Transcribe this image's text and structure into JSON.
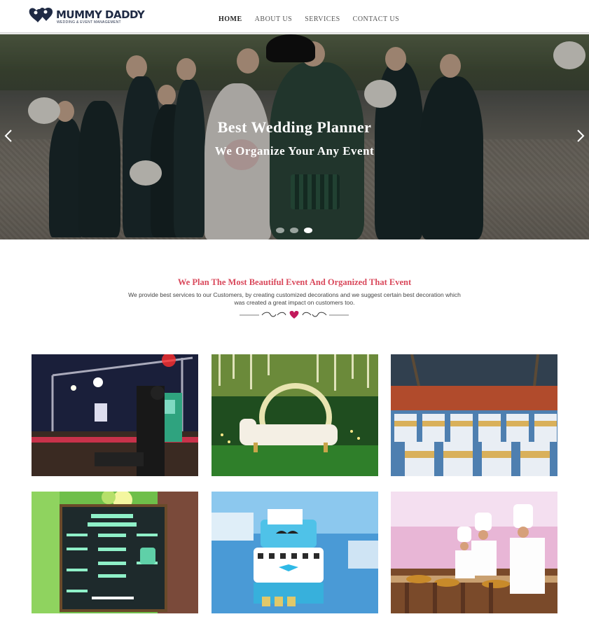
{
  "brand": {
    "title": "MUMMY DADDY",
    "tagline": "WEDDING & EVENT MANAGEMENT",
    "logo_icon": "hearts-couple-logo",
    "color": "#1f2a44"
  },
  "nav": {
    "items": [
      {
        "label": "HOME",
        "active": true
      },
      {
        "label": "ABOUT US",
        "active": false
      },
      {
        "label": "SERVICES",
        "active": false
      },
      {
        "label": "CONTACT US",
        "active": false
      }
    ]
  },
  "hero": {
    "title": "Best Wedding Planner",
    "subtitle": "We Organize Your Any Event",
    "prev_icon": "chevron-left-icon",
    "next_icon": "chevron-right-icon",
    "slides_count": 3,
    "active_slide": 3
  },
  "intro": {
    "heading": "We Plan The Most Beautiful Event And Organized That Event",
    "text": "We provide best services to our Customers, by creating customized decorations and we suggest certain best decoration which was created a great impact on customers too.",
    "accent_color": "#d9485b",
    "divider_icon": "heart-ornament-icon"
  },
  "gallery": {
    "items": [
      {
        "name": "dj-stage-night",
        "icon": "dj-stage-photo"
      },
      {
        "name": "floral-stage-sofa",
        "icon": "floral-stage-photo"
      },
      {
        "name": "outdoor-banquet-chairs",
        "icon": "banquet-chairs-photo"
      },
      {
        "name": "birthday-chalkboard",
        "icon": "birthday-board-photo"
      },
      {
        "name": "birthday-cake",
        "icon": "cake-photo"
      },
      {
        "name": "chefs-catering",
        "icon": "catering-photo"
      }
    ]
  }
}
